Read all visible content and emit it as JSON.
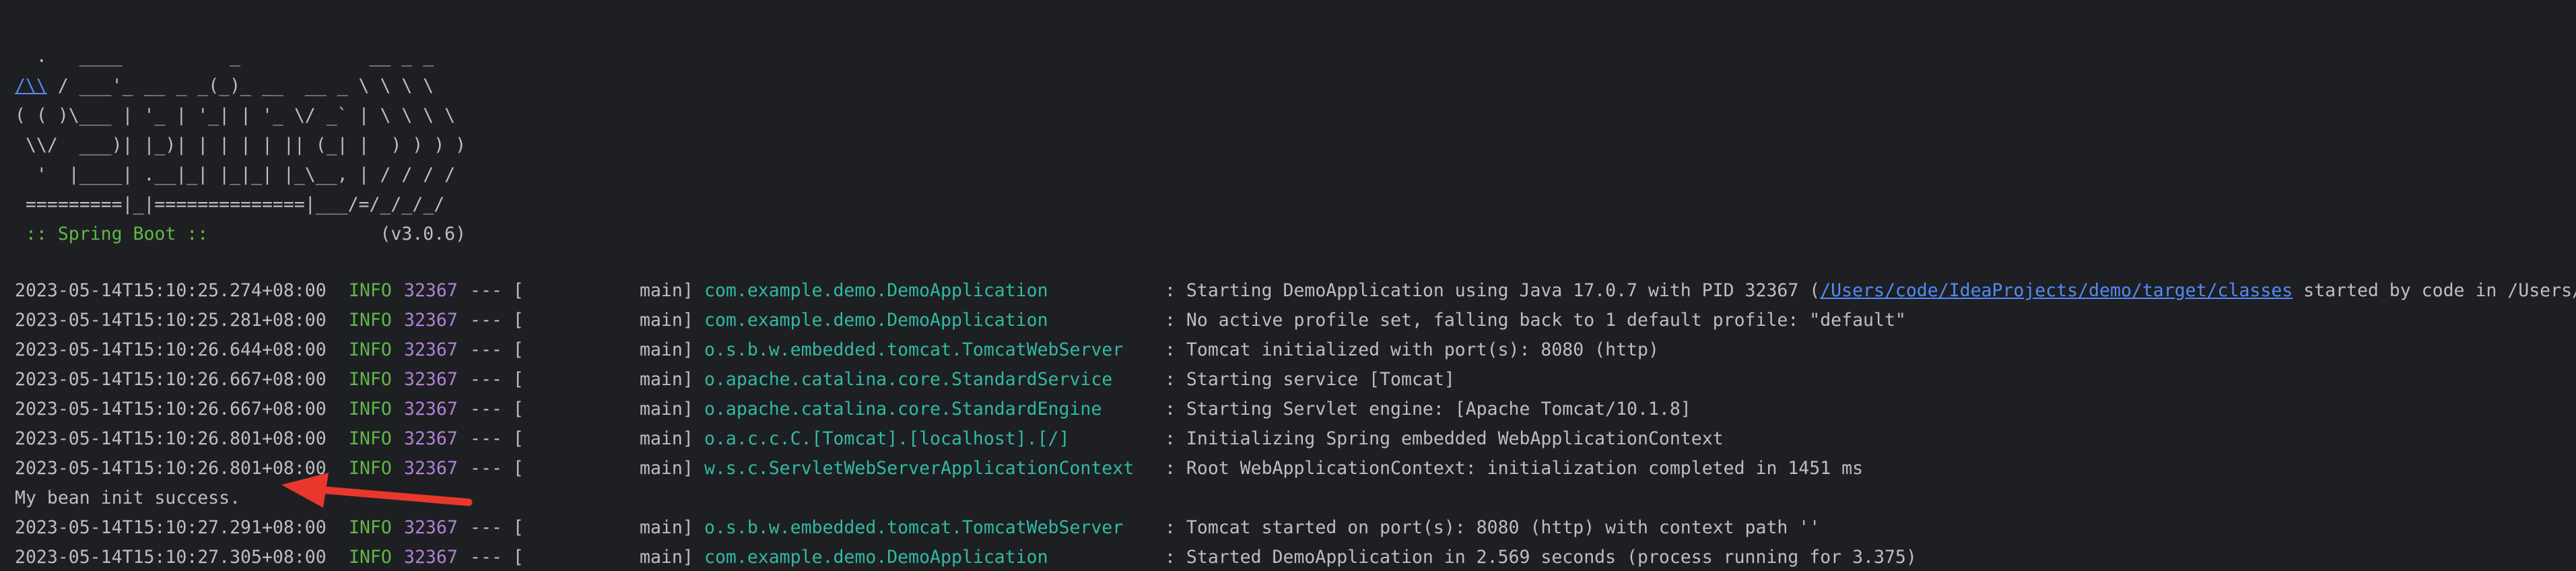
{
  "console": {
    "top_partial": "  .   ____          _            __ _ _",
    "banner_lines": [
      "  .   ____          _            __ _ _",
      " ",
      "( ( )\\___ | '_ | '_| | '_ \\/ _` | \\ \\ \\ \\",
      " \\\\/  ___)| |_)| | | | | || (_| |  ) ) ) )",
      "  '  |____| .__|_| |_|_| |_\\__, | / / / /",
      " =========|_|==============|___/=/_/_/_/"
    ],
    "banner_line2_link": "/\\\\",
    "banner_line2_rest": " / ___'_ __ _ _(_)_ __  __ _ \\ \\ \\ \\",
    "spring_tag": " :: Spring Boot :: ",
    "spring_version": "               (v3.0.6)",
    "logs": [
      {
        "timestamp": "2023-05-14T15:10:25.274+08:00",
        "level": "INFO",
        "pid": "32367",
        "sep": "--- [",
        "thread": "main]",
        "logger": "com.example.demo.DemoApplication",
        "message_prefix": ": Starting DemoApplication using Java 17.0.7 with PID 32367 (",
        "message_link": "/Users/code/IdeaProjects/demo/target/classes",
        "message_suffix": " started by code in /Users/c"
      },
      {
        "timestamp": "2023-05-14T15:10:25.281+08:00",
        "level": "INFO",
        "pid": "32367",
        "sep": "--- [",
        "thread": "main]",
        "logger": "com.example.demo.DemoApplication",
        "message": ": No active profile set, falling back to 1 default profile: \"default\""
      },
      {
        "timestamp": "2023-05-14T15:10:26.644+08:00",
        "level": "INFO",
        "pid": "32367",
        "sep": "--- [",
        "thread": "main]",
        "logger": "o.s.b.w.embedded.tomcat.TomcatWebServer",
        "message": ": Tomcat initialized with port(s): 8080 (http)"
      },
      {
        "timestamp": "2023-05-14T15:10:26.667+08:00",
        "level": "INFO",
        "pid": "32367",
        "sep": "--- [",
        "thread": "main]",
        "logger": "o.apache.catalina.core.StandardService",
        "message": ": Starting service [Tomcat]"
      },
      {
        "timestamp": "2023-05-14T15:10:26.667+08:00",
        "level": "INFO",
        "pid": "32367",
        "sep": "--- [",
        "thread": "main]",
        "logger": "o.apache.catalina.core.StandardEngine",
        "message": ": Starting Servlet engine: [Apache Tomcat/10.1.8]"
      },
      {
        "timestamp": "2023-05-14T15:10:26.801+08:00",
        "level": "INFO",
        "pid": "32367",
        "sep": "--- [",
        "thread": "main]",
        "logger": "o.a.c.c.C.[Tomcat].[localhost].[/]",
        "message": ": Initializing Spring embedded WebApplicationContext"
      },
      {
        "timestamp": "2023-05-14T15:10:26.801+08:00",
        "level": "INFO",
        "pid": "32367",
        "sep": "--- [",
        "thread": "main]",
        "logger": "w.s.c.ServletWebServerApplicationContext",
        "message": ": Root WebApplicationContext: initialization completed in 1451 ms"
      }
    ],
    "plain_output": "My bean init success.",
    "logs_after": [
      {
        "timestamp": "2023-05-14T15:10:27.291+08:00",
        "level": "INFO",
        "pid": "32367",
        "sep": "--- [",
        "thread": "main]",
        "logger": "o.s.b.w.embedded.tomcat.TomcatWebServer",
        "message": ": Tomcat started on port(s): 8080 (http) with context path ''"
      },
      {
        "timestamp": "2023-05-14T15:10:27.305+08:00",
        "level": "INFO",
        "pid": "32367",
        "sep": "--- [",
        "thread": "main]",
        "logger": "com.example.demo.DemoApplication",
        "message": ": Started DemoApplication in 2.569 seconds (process running for 3.375)"
      }
    ]
  },
  "annotation": {
    "arrow_icon": "red-arrow-icon",
    "arrow_color": "#e8372c"
  },
  "colors": {
    "background": "#1e1f22",
    "text": "#bcbec4",
    "level_info": "#5fb84a",
    "pid": "#b180d7",
    "logger": "#2fbaa3",
    "link": "#548af7"
  }
}
